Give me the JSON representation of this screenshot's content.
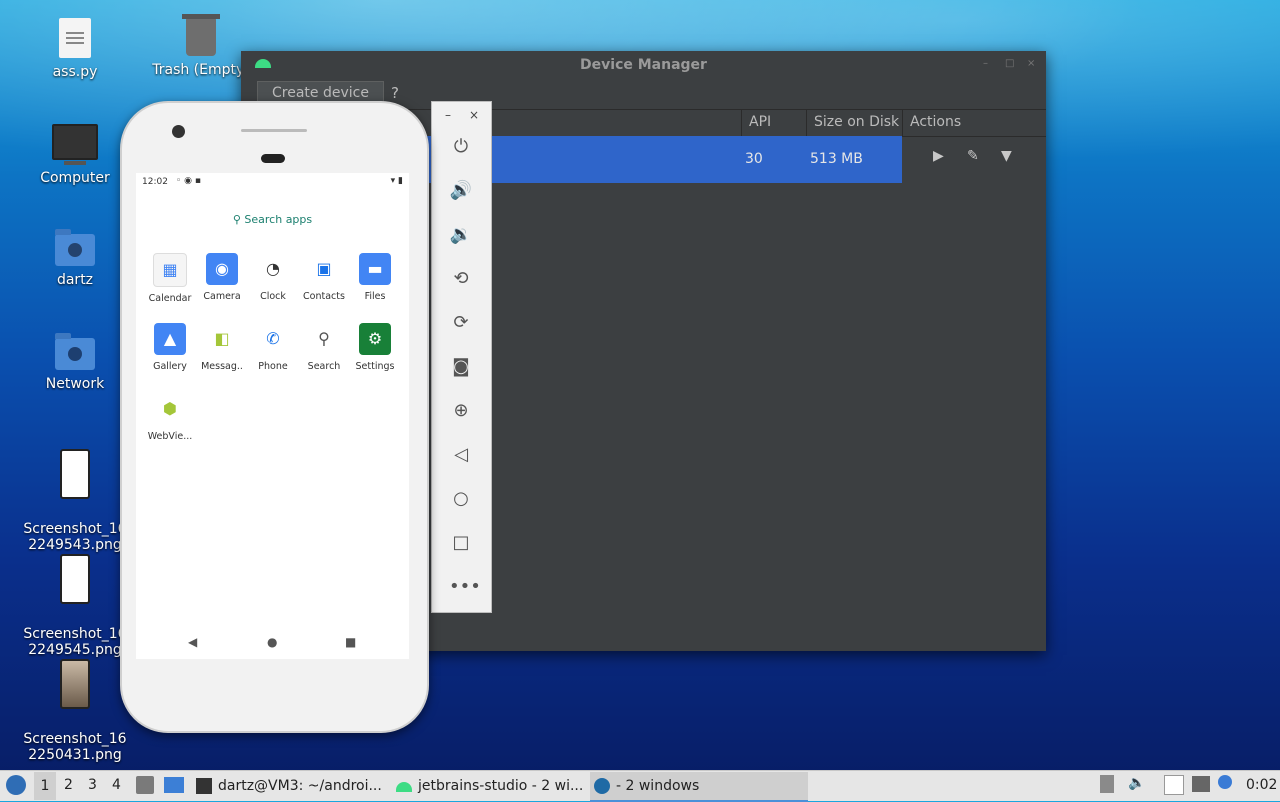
{
  "desktop": {
    "icons": [
      {
        "label": "ass.py",
        "icon": "python-file-icon"
      },
      {
        "label": "Trash (Empty)",
        "icon": "trash-icon"
      },
      {
        "label": "Computer",
        "icon": "computer-icon"
      },
      {
        "label": "dartz",
        "icon": "home-folder-icon"
      },
      {
        "label": "Network",
        "icon": "network-folder-icon"
      },
      {
        "label": "Screenshot_16\n2249543.png",
        "icon": "image-file-icon"
      },
      {
        "label": "Screenshot_16\n2249545.png",
        "icon": "image-file-icon"
      },
      {
        "label": "Screenshot_16\n2250431.png",
        "icon": "image-file-icon"
      }
    ]
  },
  "device_manager": {
    "title": "Device Manager",
    "create_device_label": "Create device",
    "help_label": "?",
    "columns": {
      "api": "API",
      "size": "Size on Disk",
      "actions": "Actions"
    },
    "rows": [
      {
        "api": "30",
        "size": "513 MB"
      }
    ]
  },
  "emulator_toolbar": {
    "minimize": "–",
    "close": "×",
    "tools": [
      "power-icon",
      "volume-up-icon",
      "volume-down-icon",
      "rotate-left-icon",
      "rotate-right-icon",
      "camera-icon",
      "zoom-icon",
      "back-icon",
      "home-icon",
      "overview-icon",
      "more-icon"
    ]
  },
  "phone": {
    "status_time": "12:02",
    "search_label": "Search apps",
    "apps": [
      {
        "label": "Calendar",
        "color": "#f5f5f5"
      },
      {
        "label": "Camera",
        "color": "#4285f4"
      },
      {
        "label": "Clock",
        "color": "#ffffff"
      },
      {
        "label": "Contacts",
        "color": "#1a73e8"
      },
      {
        "label": "Files",
        "color": "#4285f4"
      },
      {
        "label": "Gallery",
        "color": "#4285f4"
      },
      {
        "label": "Messag..",
        "color": "#a4c639"
      },
      {
        "label": "Phone",
        "color": "#ffffff"
      },
      {
        "label": "Search",
        "color": "#ffffff"
      },
      {
        "label": "Settings",
        "color": "#188038"
      },
      {
        "label": "WebVie...",
        "color": "#ffffff"
      }
    ]
  },
  "taskbar": {
    "workspaces": [
      "1",
      "2",
      "3",
      "4"
    ],
    "tasks": [
      {
        "label": "dartz@VM3: ~/androi..."
      },
      {
        "label": "jetbrains-studio - 2 wi..."
      },
      {
        "label": "- 2 windows"
      }
    ],
    "clock": "0:02"
  }
}
